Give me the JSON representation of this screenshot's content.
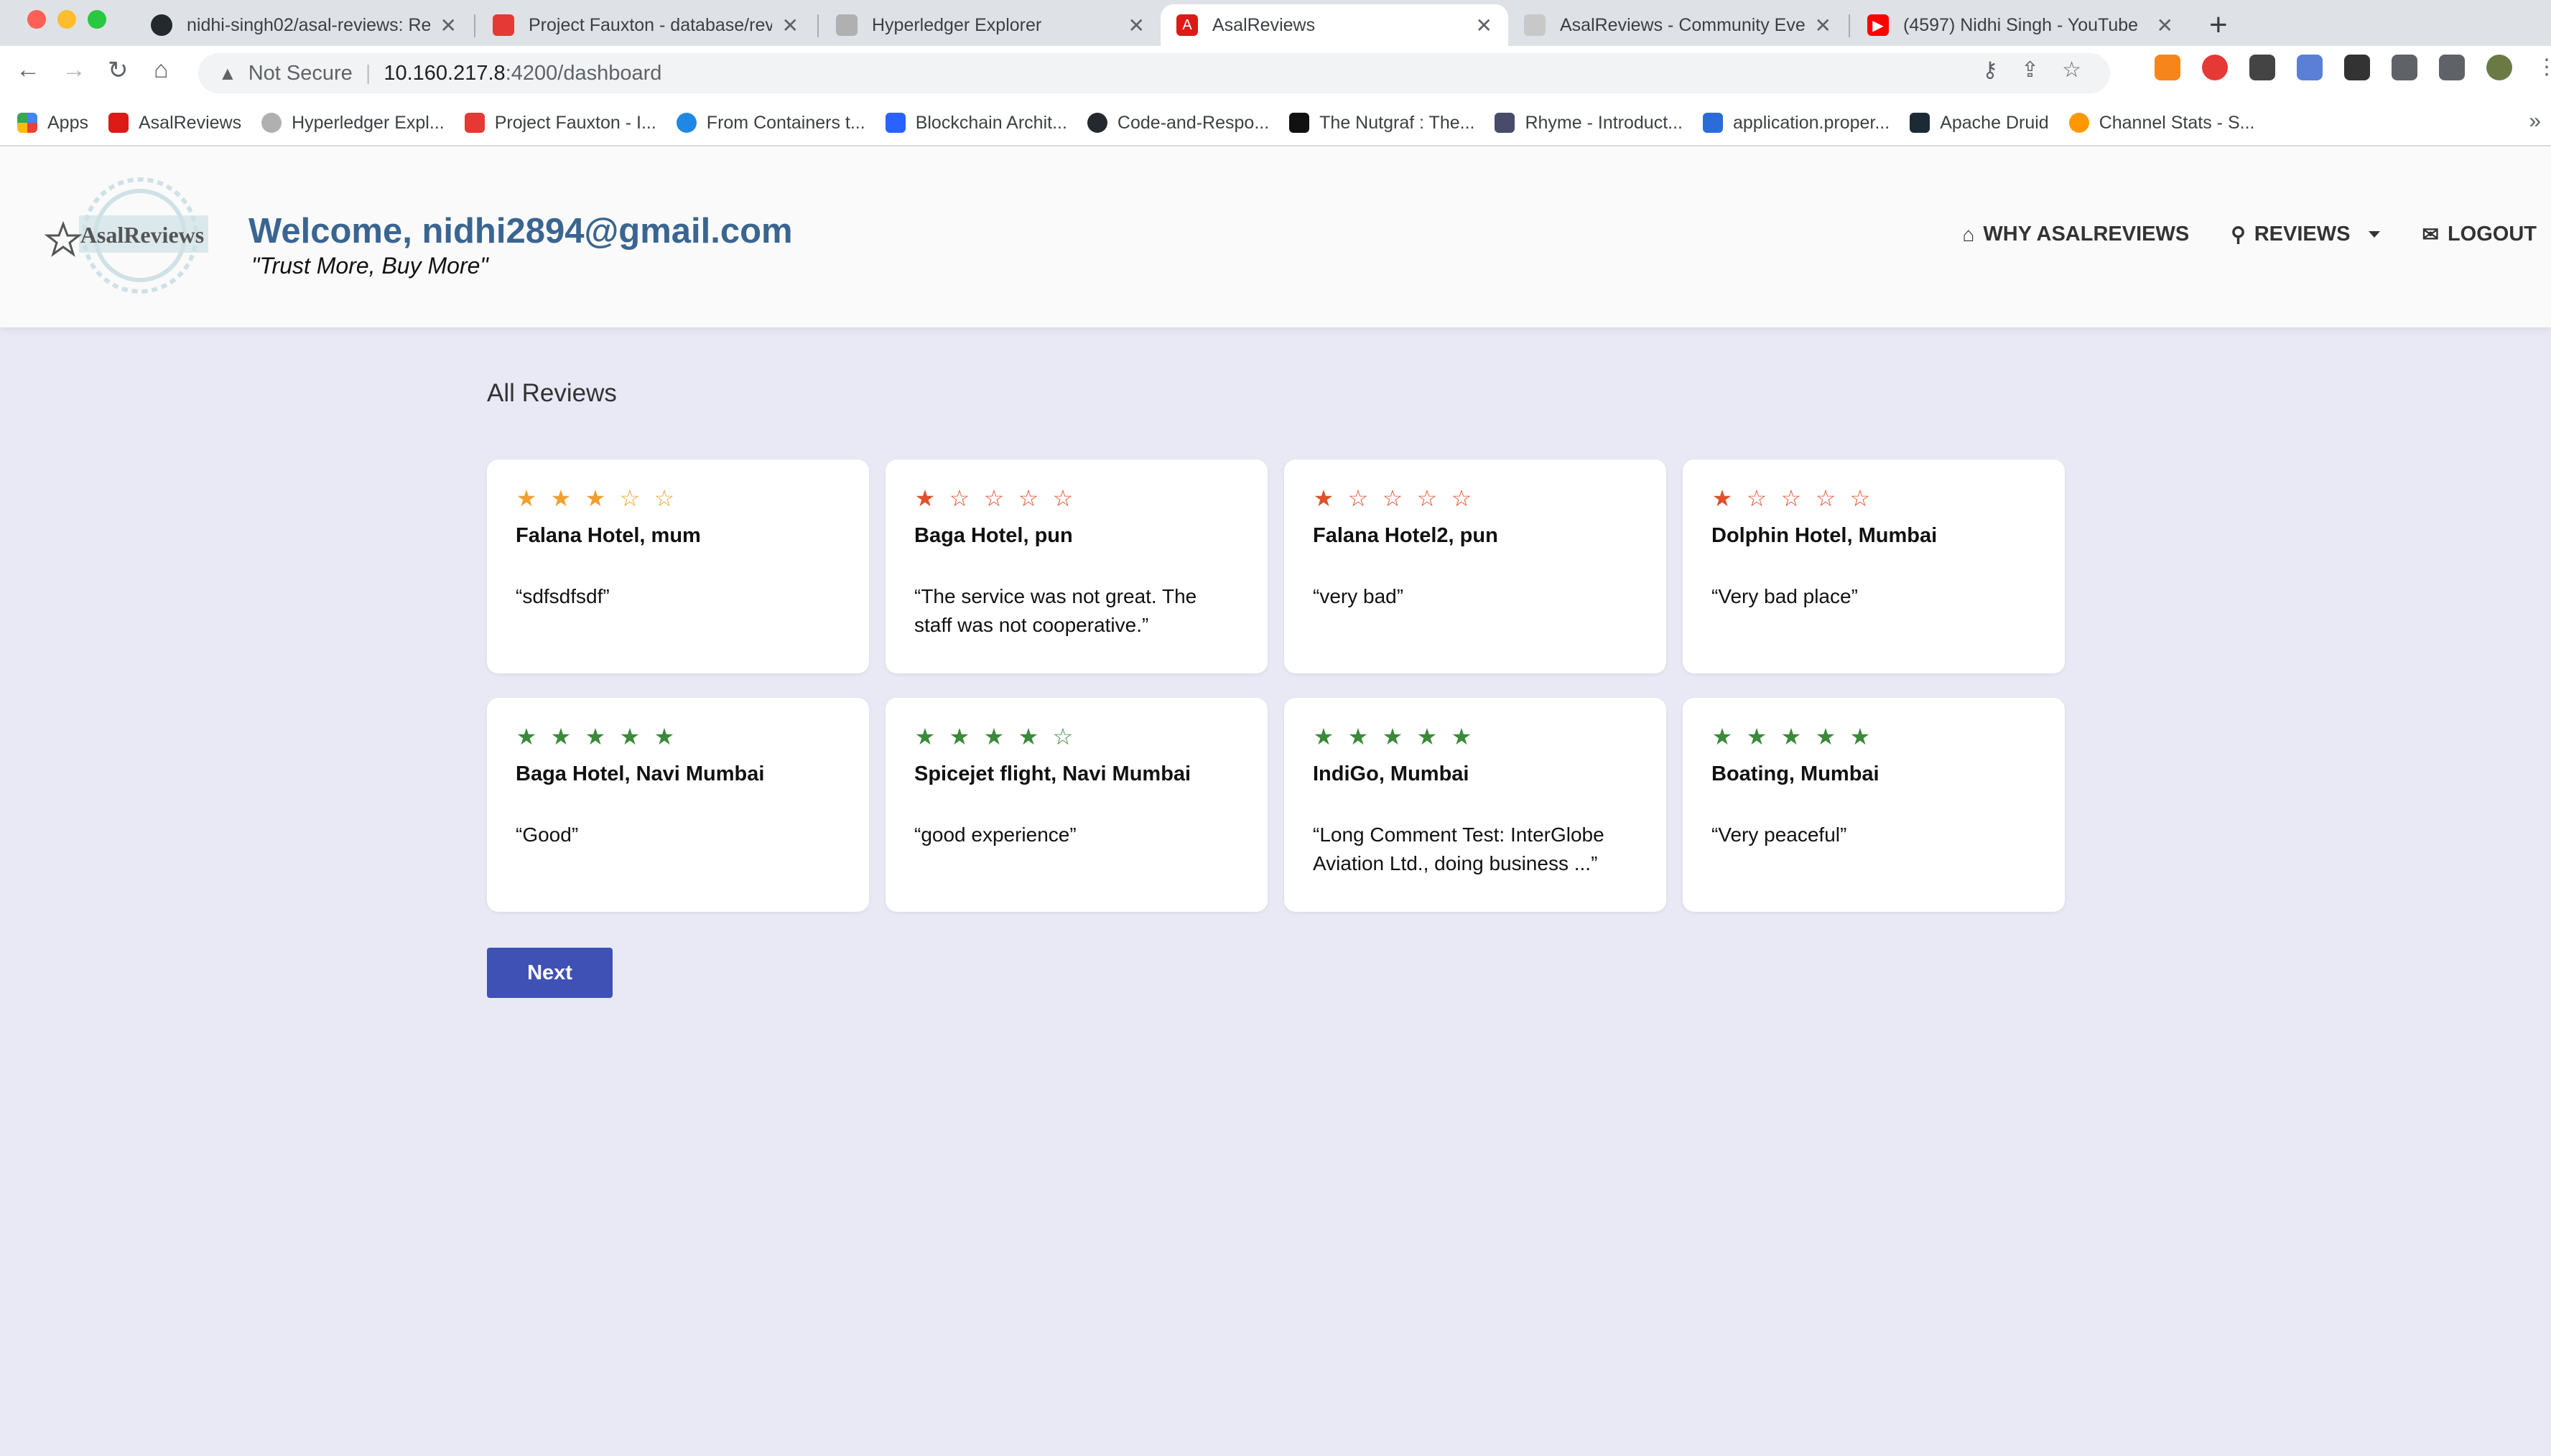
{
  "browser": {
    "tabs": [
      {
        "title": "nidhi-singh02/asal-reviews: Re",
        "favicon": "github-icon",
        "active": false
      },
      {
        "title": "Project Fauxton - database/rev",
        "favicon": "fauxton-icon",
        "active": false
      },
      {
        "title": "Hyperledger Explorer",
        "favicon": "hyperledger-icon",
        "active": false
      },
      {
        "title": "AsalReviews",
        "favicon": "angular-icon",
        "active": true
      },
      {
        "title": "AsalReviews - Community Even",
        "favicon": "generic-icon",
        "active": false
      },
      {
        "title": "(4597) Nidhi Singh - YouTube",
        "favicon": "youtube-icon",
        "active": false
      }
    ],
    "address": {
      "security": "Not Secure",
      "host": "10.160.217.8",
      "path": ":4200/dashboard"
    },
    "bookmarks": [
      {
        "label": "Apps",
        "icon": "apps-grid-icon"
      },
      {
        "label": "AsalReviews",
        "icon": "angular-icon"
      },
      {
        "label": "Hyperledger Expl...",
        "icon": "hyperledger-icon"
      },
      {
        "label": "Project Fauxton - I...",
        "icon": "fauxton-icon"
      },
      {
        "label": "From Containers t...",
        "icon": "containers-icon"
      },
      {
        "label": "Blockchain Archit...",
        "icon": "s-icon"
      },
      {
        "label": "Code-and-Respo...",
        "icon": "github-icon"
      },
      {
        "label": "The Nutgraf : The...",
        "icon": "nutgraf-icon"
      },
      {
        "label": "Rhyme - Introduct...",
        "icon": "rhyme-icon"
      },
      {
        "label": "application.proper...",
        "icon": "doc-icon"
      },
      {
        "label": "Apache Druid",
        "icon": "druid-icon"
      },
      {
        "label": "Channel Stats - S...",
        "icon": "channel-stats-icon"
      }
    ]
  },
  "header": {
    "logo_text": "AsalReviews",
    "welcome": "Welcome, nidhi2894@gmail.com",
    "tagline": "\"Trust More, Buy More\"",
    "nav": {
      "why": "WHY ASALREVIEWS",
      "reviews": "REVIEWS",
      "logout": "LOGOUT"
    }
  },
  "main": {
    "title": "All Reviews",
    "next_label": "Next",
    "reviews": [
      {
        "rating": 3,
        "title": "Falana Hotel, mum",
        "text": "“sdfsdfsdf”",
        "color": "#f0a030"
      },
      {
        "rating": 1,
        "title": "Baga Hotel, pun",
        "text": "“The service was not great. The staff was not cooperative.”",
        "color": "#e0502a"
      },
      {
        "rating": 1,
        "title": "Falana Hotel2, pun",
        "text": "“very bad”",
        "color": "#e0502a"
      },
      {
        "rating": 1,
        "title": "Dolphin Hotel, Mumbai",
        "text": "“Very bad place”",
        "color": "#e0502a"
      },
      {
        "rating": 5,
        "title": "Baga Hotel, Navi Mumbai",
        "text": "“Good”",
        "color": "#3a8a3a"
      },
      {
        "rating": 4,
        "title": "Spicejet flight, Navi Mumbai",
        "text": "“good experience”",
        "color": "#3a8a3a"
      },
      {
        "rating": 5,
        "title": "IndiGo, Mumbai",
        "text": "“Long Comment Test: InterGlobe Aviation Ltd., doing business ...”",
        "color": "#3a8a3a"
      },
      {
        "rating": 5,
        "title": "Boating, Mumbai",
        "text": "“Very peaceful”",
        "color": "#3a8a3a"
      }
    ]
  }
}
